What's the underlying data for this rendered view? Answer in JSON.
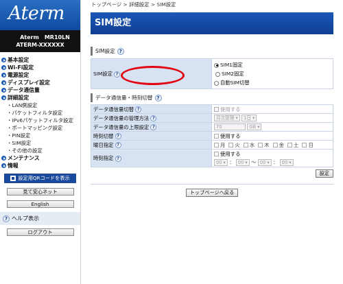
{
  "sidebar": {
    "logo": "Aterm",
    "model_line1": "Aterm　MR10LN",
    "model_line2": "ATERM-XXXXXX",
    "nav": [
      {
        "label": "基本設定"
      },
      {
        "label": "Wi-Fi設定"
      },
      {
        "label": "電源設定"
      },
      {
        "label": "ディスプレイ設定"
      },
      {
        "label": "データ通信量"
      },
      {
        "label": "詳細設定"
      }
    ],
    "sub": [
      "・LAN側設定",
      "・パケットフィルタ設定",
      "・IPv6パケットフィルタ設定",
      "・ポートマッピング設定",
      "・PIN設定",
      "・SIM設定",
      "・その他の設定"
    ],
    "nav2": [
      {
        "label": "メンテナンス"
      },
      {
        "label": "情報"
      }
    ],
    "qr_button": "設定用QRコードを表示",
    "mite_button": "見て安心ネット",
    "english_button": "English",
    "help_label": "ヘルプ表示",
    "logout_button": "ログアウト"
  },
  "breadcrumb": "トップページ > 詳細設定 > SIM設定",
  "page_title": "SIM設定",
  "section1": {
    "title": "SIM設定",
    "row_label": "SIM設定",
    "options": [
      "SIM1固定",
      "SIM2固定",
      "自動SIM切替"
    ],
    "selected": "SIM1固定"
  },
  "section2": {
    "title": "データ通信量・時刻切替",
    "rows": {
      "data_switch": {
        "label": "データ通信量切替",
        "value": "使用する"
      },
      "manage": {
        "label": "データ通信量の管理方法",
        "select1": "月次管理",
        "select2": "1日"
      },
      "limit": {
        "label": "データ通信量の上限設定",
        "value": "70",
        "unit": "GB"
      },
      "time_switch": {
        "label": "時刻切替",
        "value": "使用する"
      },
      "days": {
        "label": "曜日指定",
        "items": [
          "月",
          "火",
          "水",
          "木",
          "金",
          "土",
          "日"
        ]
      },
      "time": {
        "label": "時刻指定",
        "value": "使用する",
        "h1": "00",
        "m1": "00",
        "sep": "：",
        "tilde": "〜",
        "h2": "00",
        "m2": "00"
      }
    }
  },
  "set_button": "設定",
  "top_button": "トップページへ戻る",
  "annotation_color": "#e20512"
}
